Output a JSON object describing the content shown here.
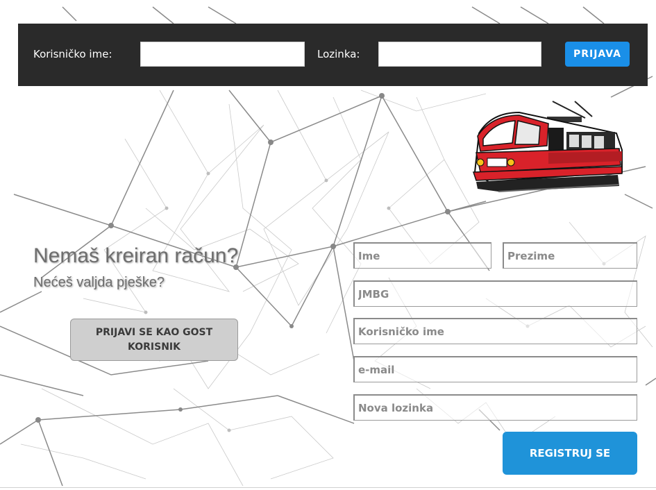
{
  "login": {
    "username_label": "Korisničko ime:",
    "username_value": "",
    "password_label": "Lozinka:",
    "password_value": "",
    "submit_label": "PRIJAVA"
  },
  "promo": {
    "headline": "Nemaš kreiran račun?",
    "subline": "Nećeš valjda pješke?"
  },
  "guest": {
    "button_label": "PRIJAVI SE KAO GOST KORISNIK"
  },
  "register": {
    "first_name_placeholder": "Ime",
    "last_name_placeholder": "Prezime",
    "jmbg_placeholder": "JMBG",
    "username_placeholder": "Korisničko ime",
    "email_placeholder": "e-mail",
    "password_placeholder": "Nova lozinka",
    "submit_label": "REGISTRUJ SE"
  },
  "colors": {
    "header_bg": "#2a2a2a",
    "login_button": "#1a8fe8",
    "register_button": "#1f93d9",
    "guest_button": "#cfcfcf",
    "tram_red": "#d9222a"
  },
  "icons": {
    "tram": "tram-illustration"
  }
}
